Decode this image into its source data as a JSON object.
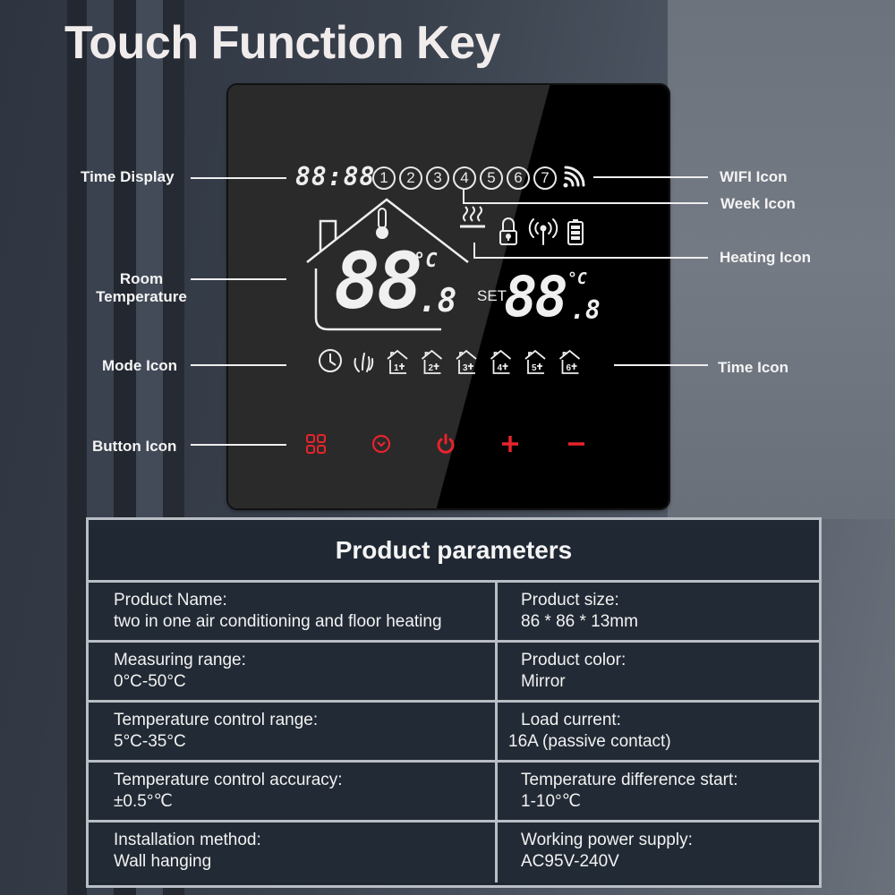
{
  "title": "Touch Function Key",
  "callouts": {
    "time_display": "Time Display",
    "room_temperature": "Room\nTemperature",
    "room_temperature_line1": "Room",
    "room_temperature_line2": "Temperature",
    "mode_icon": "Mode Icon",
    "button_icon": "Button Icon",
    "wifi_icon": "WIFI Icon",
    "week_icon": "Week Icon",
    "heating_icon": "Heating Icon",
    "time_icon": "Time Icon"
  },
  "display": {
    "time": "88:88",
    "week_days": [
      "1",
      "2",
      "3",
      "4",
      "5",
      "6",
      "7"
    ],
    "room_temp": "88",
    "room_temp_decimal": ".8",
    "temp_unit": "°C",
    "set_label": "SET",
    "set_temp": "88",
    "set_temp_decimal": ".8",
    "status_icons": [
      "heating-icon",
      "lock-icon",
      "signal-icon",
      "battery-icon"
    ],
    "mode_icons": [
      "clock-icon",
      "manual-hand-icon",
      "home-period-1-icon",
      "home-period-2-icon",
      "home-period-3-icon",
      "home-period-4-icon",
      "home-period-5-icon",
      "home-period-6-icon"
    ],
    "mode_period_numbers": [
      "1",
      "2",
      "3",
      "4",
      "5",
      "6"
    ],
    "touch_buttons": [
      {
        "name": "menu-button",
        "icon": "grid-icon"
      },
      {
        "name": "clock-button",
        "icon": "clock-icon"
      },
      {
        "name": "power-button",
        "icon": "power-icon"
      },
      {
        "name": "plus-button",
        "icon": "plus-icon"
      },
      {
        "name": "minus-button",
        "icon": "minus-icon"
      }
    ],
    "button_color": "#e8232c",
    "lcd_color": "#eeeeee"
  },
  "parameters": {
    "header": "Product parameters",
    "rows": [
      {
        "left": {
          "label": "Product Name:",
          "value": "two in one air conditioning and floor heating"
        },
        "right": {
          "label": "Product size:",
          "value": "86 * 86 * 13mm"
        }
      },
      {
        "left": {
          "label": "Measuring range:",
          "value": "0°C-50°C"
        },
        "right": {
          "label": "Product color:",
          "value": "Mirror"
        }
      },
      {
        "left": {
          "label": "Temperature control range:",
          "value": "5°C-35°C"
        },
        "right": {
          "label": "Load current:",
          "value": "16A (passive contact)"
        }
      },
      {
        "left": {
          "label": "Temperature control accuracy:",
          "value": "±0.5°℃"
        },
        "right": {
          "label": "Temperature difference start:",
          "value": "1-10°℃"
        }
      },
      {
        "left": {
          "label": "Installation method:",
          "value": "Wall hanging"
        },
        "right": {
          "label": "Working power supply:",
          "value": "AC95V-240V"
        }
      }
    ]
  }
}
